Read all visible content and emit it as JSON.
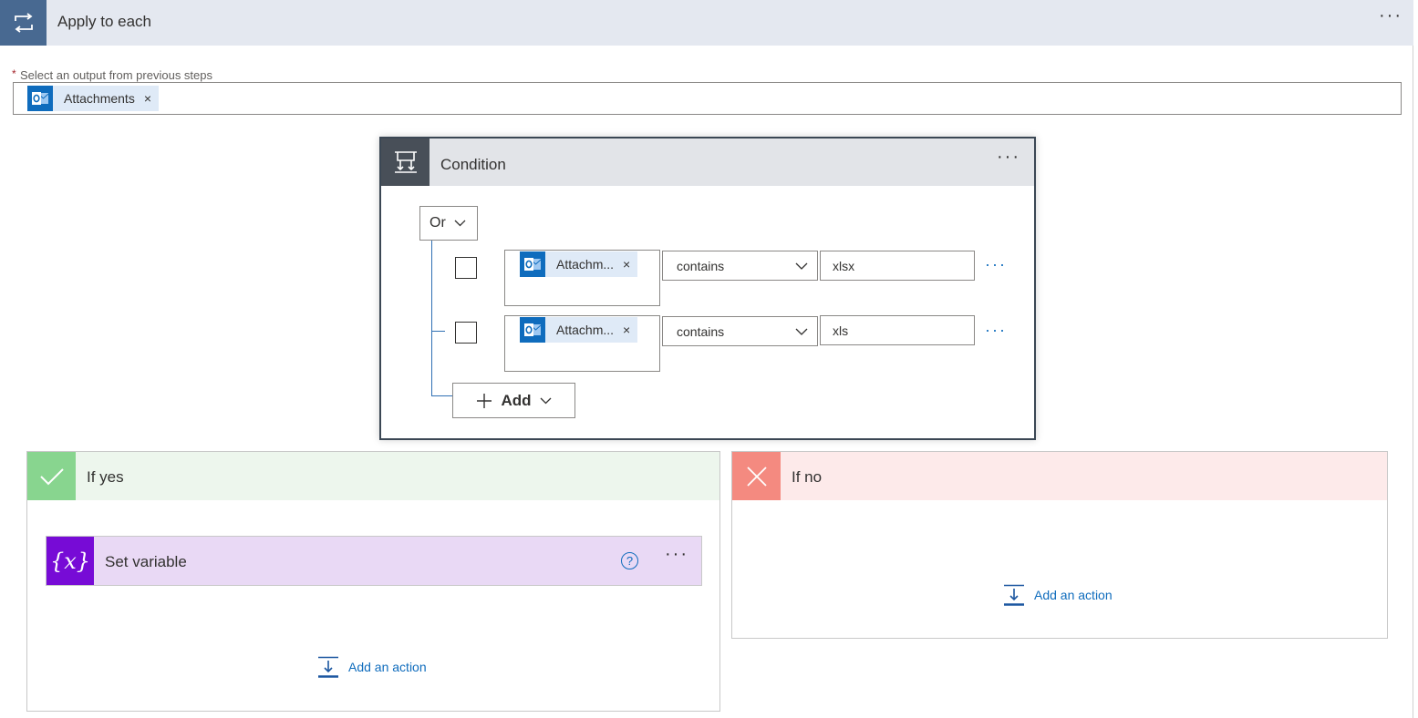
{
  "apply_to_each": {
    "title": "Apply to each",
    "more": "···",
    "select_label": "Select an output from previous steps",
    "required_marker": "*",
    "token": {
      "label": "Attachments",
      "remove": "×",
      "icon": "outlook-icon"
    }
  },
  "condition": {
    "title": "Condition",
    "more": "···",
    "group_operator": "Or",
    "rows": [
      {
        "token_label": "Attachm...",
        "remove": "×",
        "operator": "contains",
        "value": "xlsx",
        "more": "···"
      },
      {
        "token_label": "Attachm...",
        "remove": "×",
        "operator": "contains",
        "value": "xls",
        "more": "···"
      }
    ],
    "add_button": "Add"
  },
  "if_yes": {
    "title": "If yes",
    "action": {
      "title": "Set variable",
      "help": "?",
      "more": "···"
    },
    "add_action": "Add an action"
  },
  "if_no": {
    "title": "If no",
    "add_action": "Add an action"
  },
  "colors": {
    "accent": "#0f6cbd",
    "loop_header": "#486991",
    "condition_header": "#484f58",
    "yes": "#88d58f",
    "no": "#f48a80",
    "variable": "#770bd6"
  }
}
